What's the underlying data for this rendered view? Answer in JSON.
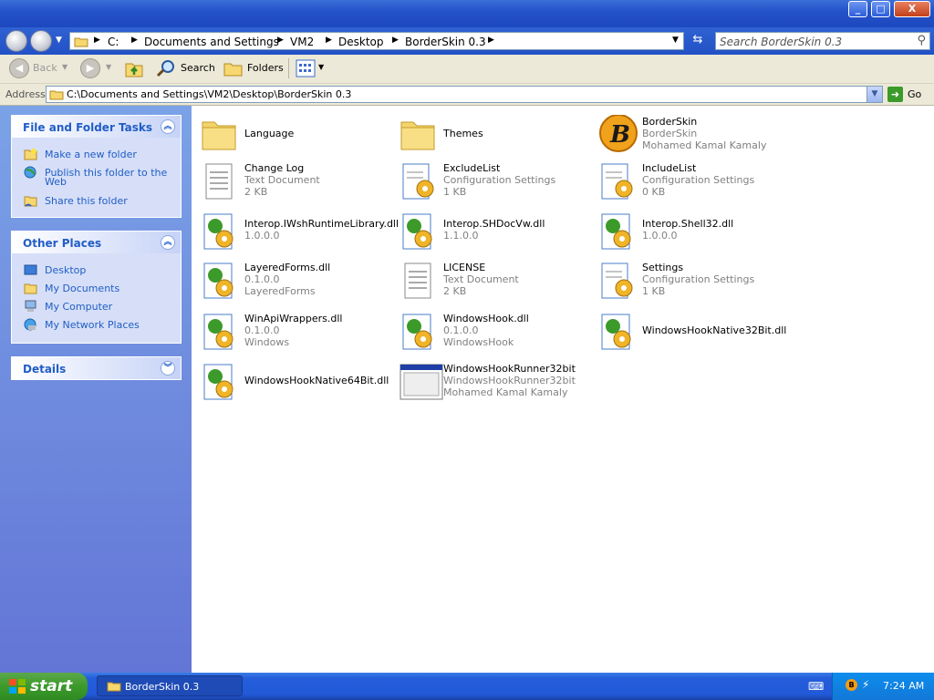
{
  "window": {
    "min": "_",
    "max": "□",
    "close": "X"
  },
  "breadcrumbs": [
    "C:",
    "Documents and Settings",
    "VM2",
    "Desktop",
    "BorderSkin 0.3"
  ],
  "search": {
    "placeholder": "Search BorderSkin 0.3"
  },
  "toolbar": {
    "back": "Back",
    "search": "Search",
    "folders": "Folders"
  },
  "address": {
    "label": "Address",
    "path": "C:\\Documents and Settings\\VM2\\Desktop\\BorderSkin 0.3",
    "go": "Go"
  },
  "sidebar": {
    "tasks": {
      "title": "File and Folder Tasks",
      "items": [
        "Make a new folder",
        "Publish this folder to the",
        "Web",
        "Share this folder"
      ]
    },
    "places": {
      "title": "Other Places",
      "items": [
        "Desktop",
        "My Documents",
        "My Computer",
        "My Network Places"
      ]
    },
    "details": {
      "title": "Details"
    }
  },
  "files": [
    {
      "name": "Language",
      "l2": "",
      "l3": "",
      "icon": "folder"
    },
    {
      "name": "Themes",
      "l2": "",
      "l3": "",
      "icon": "folder"
    },
    {
      "name": "BorderSkin",
      "l2": "BorderSkin",
      "l3": "Mohamed Kamal Kamaly",
      "icon": "app-logo"
    },
    {
      "name": "Change Log",
      "l2": "Text Document",
      "l3": "2 KB",
      "icon": "text"
    },
    {
      "name": "ExcludeList",
      "l2": "Configuration Settings",
      "l3": "1 KB",
      "icon": "config"
    },
    {
      "name": "IncludeList",
      "l2": "Configuration Settings",
      "l3": "0 KB",
      "icon": "config"
    },
    {
      "name": "Interop.IWshRuntimeLibrary.dll",
      "l2": "1.0.0.0",
      "l3": "",
      "icon": "dll"
    },
    {
      "name": "Interop.SHDocVw.dll",
      "l2": "1.1.0.0",
      "l3": "",
      "icon": "dll"
    },
    {
      "name": "Interop.Shell32.dll",
      "l2": "1.0.0.0",
      "l3": "",
      "icon": "dll"
    },
    {
      "name": "LayeredForms.dll",
      "l2": "0.1.0.0",
      "l3": "LayeredForms",
      "icon": "dll"
    },
    {
      "name": "LICENSE",
      "l2": "Text Document",
      "l3": "2 KB",
      "icon": "text"
    },
    {
      "name": "Settings",
      "l2": "Configuration Settings",
      "l3": "1 KB",
      "icon": "config"
    },
    {
      "name": "WinApiWrappers.dll",
      "l2": "0.1.0.0",
      "l3": "Windows",
      "icon": "dll"
    },
    {
      "name": "WindowsHook.dll",
      "l2": "0.1.0.0",
      "l3": "WindowsHook",
      "icon": "dll"
    },
    {
      "name": "WindowsHookNative32Bit.dll",
      "l2": "",
      "l3": "",
      "icon": "dll"
    },
    {
      "name": "WindowsHookNative64Bit.dll",
      "l2": "",
      "l3": "",
      "icon": "dll"
    },
    {
      "name": "WindowsHookRunner32bit",
      "l2": "WindowsHookRunner32bit",
      "l3": "Mohamed Kamal Kamaly",
      "icon": "exe"
    }
  ],
  "taskbar": {
    "start": "start",
    "task": "BorderSkin 0.3",
    "clock": "7:24 AM"
  },
  "colors": {
    "xpBlue": "#245edb",
    "linkBlue": "#215dc6",
    "startGreen": "#3c9a2b"
  }
}
